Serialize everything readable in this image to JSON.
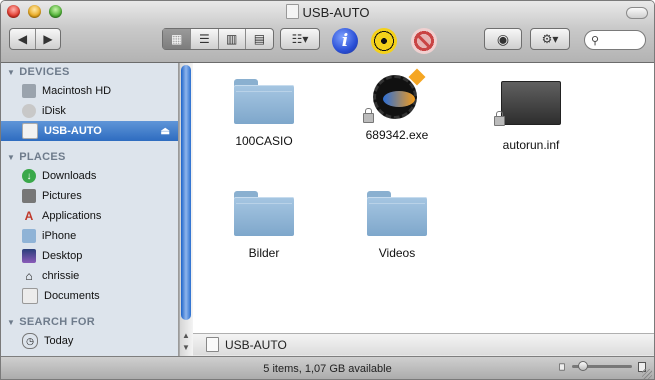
{
  "window": {
    "title": "USB-AUTO",
    "traffic_lights": [
      "close",
      "minimize",
      "zoom"
    ]
  },
  "toolbar": {
    "back_icon": "back-arrow-icon",
    "forward_icon": "forward-arrow-icon",
    "view_modes": [
      "icon-view",
      "list-view",
      "column-view",
      "cover-flow"
    ],
    "active_view": "icon-view",
    "arrange_icon": "arrange-icon",
    "info_label": "i",
    "search_placeholder": ""
  },
  "sidebar": {
    "devices_header": "DEVICES",
    "devices": [
      {
        "label": "Macintosh HD",
        "icon": "hard-disk-icon"
      },
      {
        "label": "iDisk",
        "icon": "idisk-icon"
      },
      {
        "label": "USB-AUTO",
        "icon": "usb-drive-icon",
        "selected": true
      }
    ],
    "places_header": "PLACES",
    "places": [
      {
        "label": "Downloads",
        "icon": "download-icon"
      },
      {
        "label": "Pictures",
        "icon": "camera-icon"
      },
      {
        "label": "Applications",
        "icon": "applications-icon"
      },
      {
        "label": "iPhone",
        "icon": "folder-icon"
      },
      {
        "label": "Desktop",
        "icon": "desktop-icon"
      },
      {
        "label": "chrissie",
        "icon": "home-icon"
      },
      {
        "label": "Documents",
        "icon": "documents-icon"
      }
    ],
    "search_header": "SEARCH FOR",
    "search": [
      {
        "label": "Today",
        "icon": "clock-icon"
      }
    ]
  },
  "files": [
    {
      "name": "100CASIO",
      "kind": "folder"
    },
    {
      "name": "689342.exe",
      "kind": "exe",
      "locked": true
    },
    {
      "name": "autorun.inf",
      "kind": "inf",
      "locked": true
    },
    {
      "name": "Bilder",
      "kind": "folder"
    },
    {
      "name": "Videos",
      "kind": "folder"
    }
  ],
  "path_bar": {
    "label": "USB-AUTO"
  },
  "status": {
    "text": "5 items, 1,07 GB available"
  },
  "colors": {
    "selection": "#3874c8",
    "sidebar_bg": "#dde4ec",
    "folder": "#8fb3d6"
  }
}
